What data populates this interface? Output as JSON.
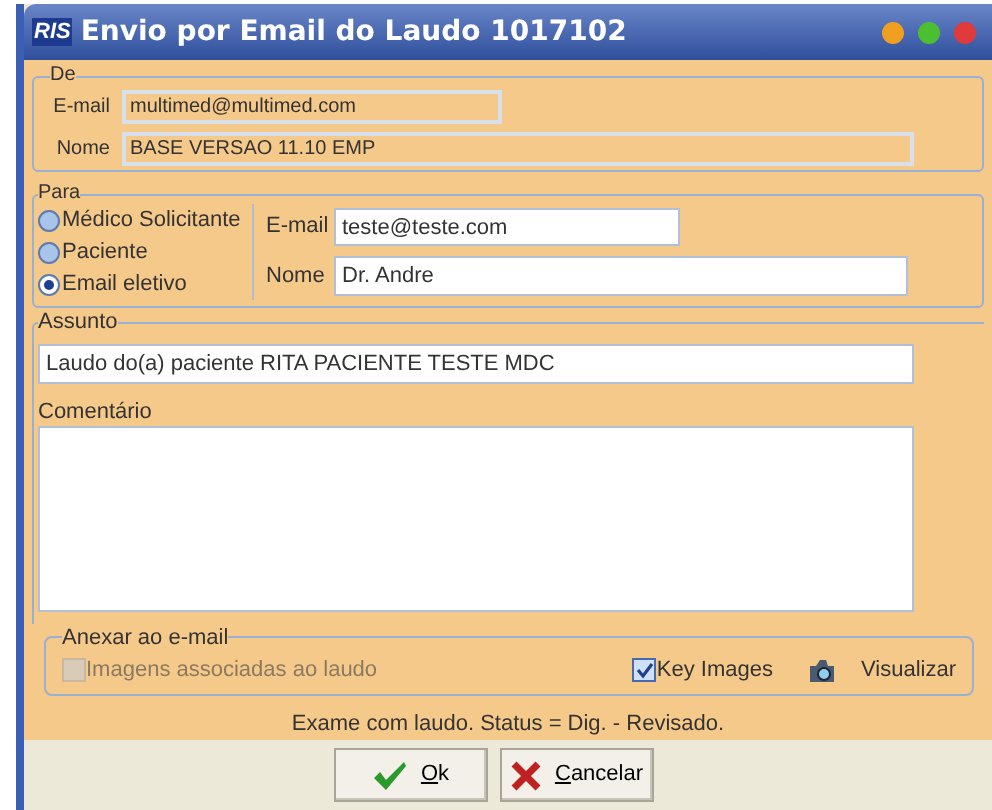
{
  "window": {
    "title": "Envio por Email do Laudo 1017102",
    "logo": "RIS"
  },
  "de": {
    "legend": "De",
    "email_label": "E-mail",
    "email": "multimed@multimed.com",
    "nome_label": "Nome",
    "nome": "BASE VERSAO 11.10 EMP"
  },
  "para": {
    "legend": "Para",
    "options": [
      {
        "label": "Médico Solicitante",
        "selected": false
      },
      {
        "label": "Paciente",
        "selected": false
      },
      {
        "label": "Email eletivo",
        "selected": true
      }
    ],
    "email_label": "E-mail",
    "email": "teste@teste.com",
    "nome_label": "Nome",
    "nome": "Dr. Andre"
  },
  "assunto": {
    "legend": "Assunto",
    "value": "Laudo do(a) paciente RITA PACIENTE TESTE MDC"
  },
  "comentario": {
    "label": "Comentário"
  },
  "anexar": {
    "legend": "Anexar ao e-mail",
    "checks": [
      {
        "label": "Imagens associadas ao laudo",
        "checked": false,
        "disabled": true
      },
      {
        "label": "Key Images",
        "checked": true,
        "disabled": false
      }
    ],
    "view_button": "Visualizar"
  },
  "status": "Exame com laudo. Status = Dig. - Revisado.",
  "buttons": [
    {
      "label": "Ok",
      "kind": "ok"
    },
    {
      "label": "Cancelar",
      "kind": "cancel"
    }
  ]
}
